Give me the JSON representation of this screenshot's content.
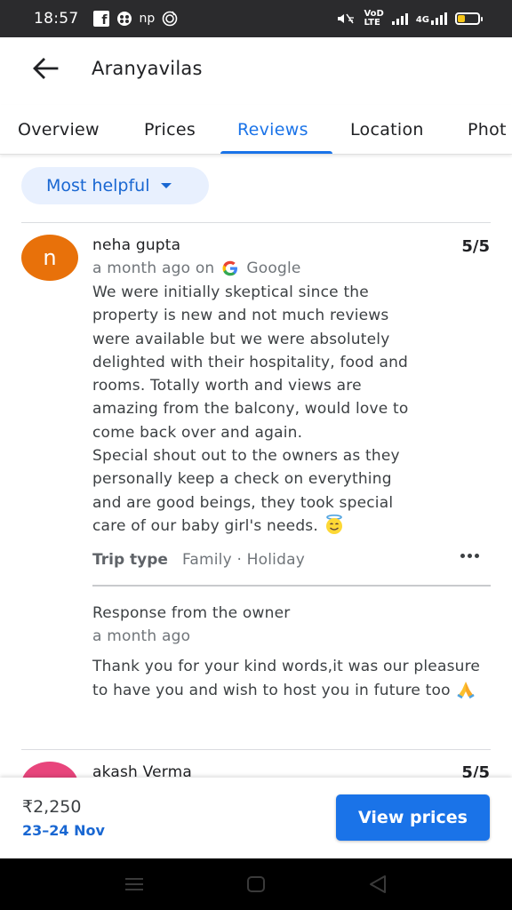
{
  "status_bar": {
    "time": "18:57",
    "left_icons": [
      "facebook-icon",
      "game-icon",
      "np-icon",
      "music-icon"
    ],
    "np_label": "np",
    "network_label_top": "VoD",
    "network_label_bottom": "LTE",
    "lte_label": "4G",
    "battery_color": "#f5c518"
  },
  "header": {
    "title": "Aranyavilas",
    "back_icon": "arrow-left-icon"
  },
  "tabs": [
    {
      "label": "Overview"
    },
    {
      "label": "Prices"
    },
    {
      "label": "Reviews"
    },
    {
      "label": "Location"
    },
    {
      "label": "Phot"
    }
  ],
  "active_tab": "Reviews",
  "sort": {
    "label": "Most helpful",
    "icon": "caret-down-icon"
  },
  "reviews": [
    {
      "avatar_letter": "n",
      "avatar_color": "#e8710a",
      "name": "neha gupta",
      "rating": "5/5",
      "time": "a month ago on",
      "source": "Google",
      "text": "We were initially skeptical since the\nproperty is new and not much reviews\nwere available but we were absolutely\ndelighted with their hospitality, food and\nrooms. Totally worth and views are\namazing from the balcony, would love to\ncome back over and again.\nSpecial shout out to the owners as they\npersonally keep a check on everything\nand are good beings, they took special\ncare of our baby girl's needs.",
      "emoji": "smiling-halo-emoji",
      "trip_type_label": "Trip type",
      "trip_type_value": "Family · Holiday",
      "owner_response": {
        "title": "Response from the owner",
        "time": "a month ago",
        "text": "Thank you for your kind words,it was our pleasure to have you and wish to host you in future too",
        "emoji": "folded-hands-emoji"
      }
    },
    {
      "avatar_letter": "",
      "avatar_color": "#e8457c",
      "name": "akash Verma",
      "rating": "5/5"
    }
  ],
  "booking": {
    "price": "₹2,250",
    "dates": "23–24 Nov",
    "button_label": "View prices",
    "accent": "#1a73e8"
  },
  "nav_bar": {
    "icons": [
      "menu-icon",
      "home-icon",
      "back-icon"
    ]
  }
}
